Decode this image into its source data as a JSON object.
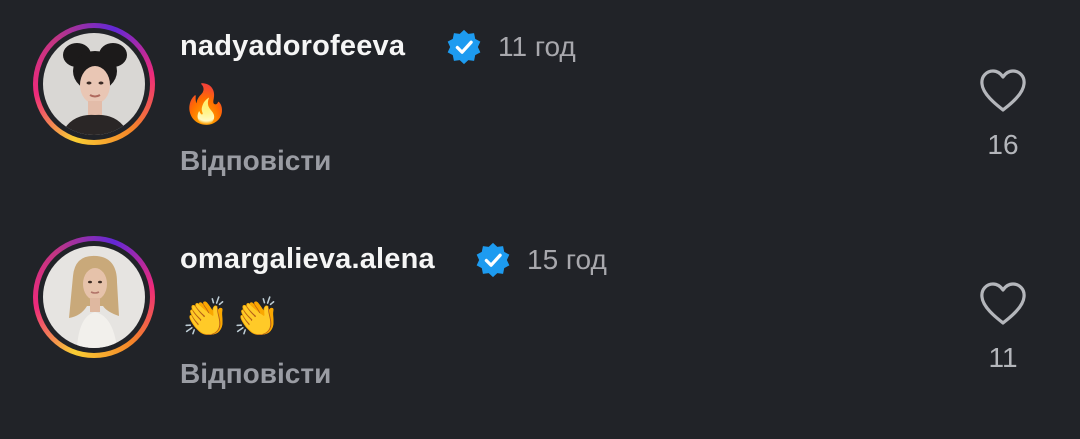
{
  "comments": [
    {
      "username": "nadyadorofeeva",
      "verified": true,
      "time": "11 год",
      "text_emoji": [
        "🔥"
      ],
      "reply_label": "Відповісти",
      "likes": "16",
      "avatar": "profile-photo-woman-dark-hair-buns",
      "avatar_ring": "story-gradient"
    },
    {
      "username": "omargalieva.alena",
      "verified": true,
      "time": "15 год",
      "text_emoji": [
        "👏",
        "👏"
      ],
      "reply_label": "Відповісти",
      "likes": "11",
      "avatar": "profile-photo-woman-blonde-hair",
      "avatar_ring": "story-gradient"
    }
  ],
  "icons": {
    "verified": "verified-badge-icon",
    "like": "heart-outline-icon"
  },
  "colors": {
    "background": "#212328",
    "verified_blue": "#1d9bf0",
    "secondary_text": "#a8a8ad"
  }
}
